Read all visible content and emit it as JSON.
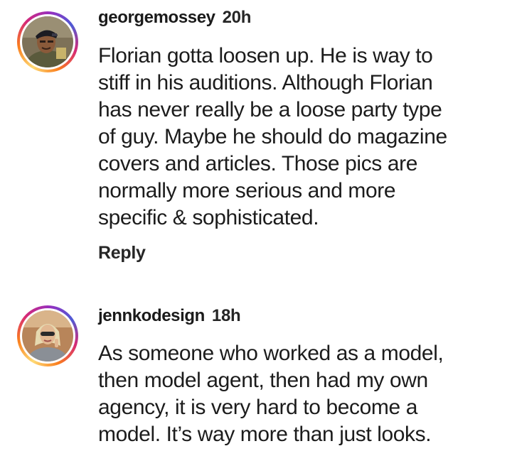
{
  "comments": [
    {
      "username": "georgemossey",
      "time": "20h",
      "avatar": "profile-photo-man-in-cap",
      "lines": [
        "Florian gotta loosen up. He is way to",
        "stiff in his auditions. Although Florian",
        "has never really be a loose party type",
        "of guy. Maybe he should do magazine",
        "covers and articles. Those pics are",
        "normally more serious and more",
        "specific & sophisticated."
      ],
      "reply_label": "Reply"
    },
    {
      "username": "jennkodesign",
      "time": "18h",
      "avatar": "profile-photo-woman-blonde",
      "lines": [
        "As someone who worked as a model,",
        "then model agent, then had my own",
        "agency, it is very hard to become a",
        "model. It’s way more than just looks."
      ]
    }
  ],
  "colors": {
    "story_ring": [
      "#feda75",
      "#fa7e1e",
      "#d62976",
      "#962fbf",
      "#4f5bd5"
    ],
    "text": "#262626",
    "background": "#ffffff"
  }
}
